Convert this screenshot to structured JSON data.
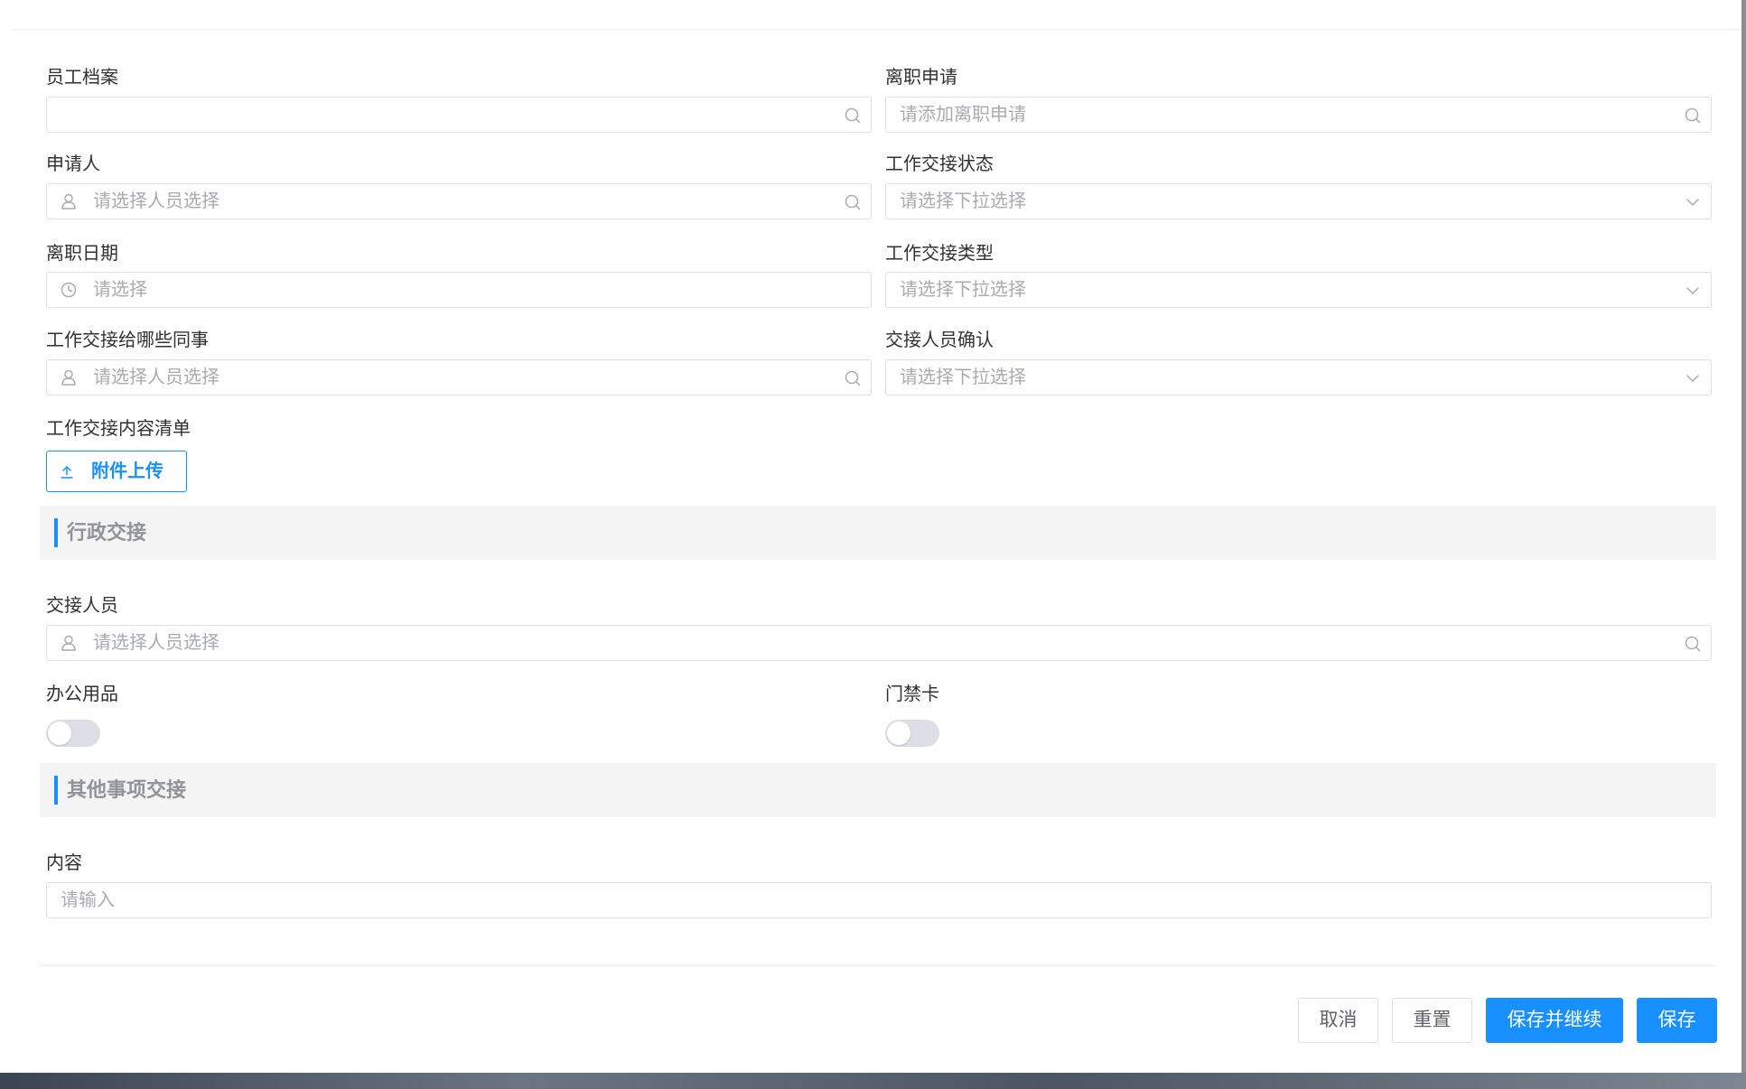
{
  "form": {
    "employee_file": {
      "label": "员工档案",
      "placeholder": ""
    },
    "resignation_request": {
      "label": "离职申请",
      "placeholder": "请添加离职申请"
    },
    "applicant": {
      "label": "申请人",
      "placeholder": "请选择人员选择"
    },
    "handover_status": {
      "label": "工作交接状态",
      "placeholder": "请选择下拉选择"
    },
    "resignation_date": {
      "label": "离职日期",
      "placeholder": "请选择"
    },
    "handover_type": {
      "label": "工作交接类型",
      "placeholder": "请选择下拉选择"
    },
    "handover_colleagues": {
      "label": "工作交接给哪些同事",
      "placeholder": "请选择人员选择"
    },
    "handover_confirm": {
      "label": "交接人员确认",
      "placeholder": "请选择下拉选择"
    },
    "handover_list": {
      "label": "工作交接内容清单",
      "upload_button": "附件上传"
    }
  },
  "sections": {
    "admin": {
      "title": "行政交接",
      "handover_person": {
        "label": "交接人员",
        "placeholder": "请选择人员选择"
      },
      "office_supplies": {
        "label": "办公用品",
        "enabled": false
      },
      "access_card": {
        "label": "门禁卡",
        "enabled": false
      }
    },
    "other": {
      "title": "其他事项交接",
      "content": {
        "label": "内容",
        "placeholder": "请输入"
      }
    }
  },
  "footer": {
    "cancel": "取消",
    "reset": "重置",
    "save_continue": "保存并继续",
    "save": "保存"
  },
  "colors": {
    "primary": "#1890ff",
    "border": "#dcdfe6",
    "placeholder": "#a8abb2",
    "section_bg": "#f4f4f5"
  }
}
